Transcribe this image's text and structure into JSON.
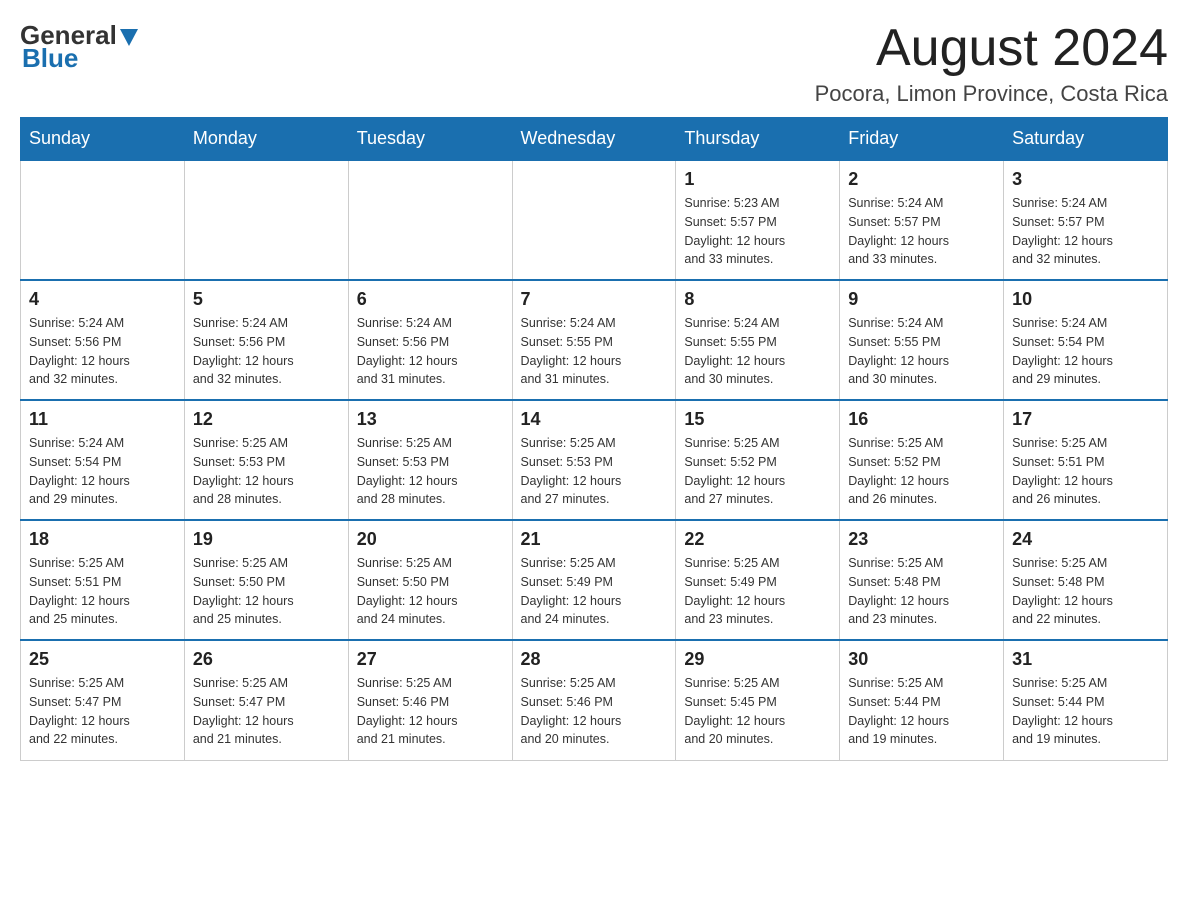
{
  "header": {
    "logo_general": "General",
    "logo_blue": "Blue",
    "month_year": "August 2024",
    "location": "Pocora, Limon Province, Costa Rica"
  },
  "calendar": {
    "days_of_week": [
      "Sunday",
      "Monday",
      "Tuesday",
      "Wednesday",
      "Thursday",
      "Friday",
      "Saturday"
    ],
    "weeks": [
      [
        {
          "day": "",
          "info": ""
        },
        {
          "day": "",
          "info": ""
        },
        {
          "day": "",
          "info": ""
        },
        {
          "day": "",
          "info": ""
        },
        {
          "day": "1",
          "info": "Sunrise: 5:23 AM\nSunset: 5:57 PM\nDaylight: 12 hours\nand 33 minutes."
        },
        {
          "day": "2",
          "info": "Sunrise: 5:24 AM\nSunset: 5:57 PM\nDaylight: 12 hours\nand 33 minutes."
        },
        {
          "day": "3",
          "info": "Sunrise: 5:24 AM\nSunset: 5:57 PM\nDaylight: 12 hours\nand 32 minutes."
        }
      ],
      [
        {
          "day": "4",
          "info": "Sunrise: 5:24 AM\nSunset: 5:56 PM\nDaylight: 12 hours\nand 32 minutes."
        },
        {
          "day": "5",
          "info": "Sunrise: 5:24 AM\nSunset: 5:56 PM\nDaylight: 12 hours\nand 32 minutes."
        },
        {
          "day": "6",
          "info": "Sunrise: 5:24 AM\nSunset: 5:56 PM\nDaylight: 12 hours\nand 31 minutes."
        },
        {
          "day": "7",
          "info": "Sunrise: 5:24 AM\nSunset: 5:55 PM\nDaylight: 12 hours\nand 31 minutes."
        },
        {
          "day": "8",
          "info": "Sunrise: 5:24 AM\nSunset: 5:55 PM\nDaylight: 12 hours\nand 30 minutes."
        },
        {
          "day": "9",
          "info": "Sunrise: 5:24 AM\nSunset: 5:55 PM\nDaylight: 12 hours\nand 30 minutes."
        },
        {
          "day": "10",
          "info": "Sunrise: 5:24 AM\nSunset: 5:54 PM\nDaylight: 12 hours\nand 29 minutes."
        }
      ],
      [
        {
          "day": "11",
          "info": "Sunrise: 5:24 AM\nSunset: 5:54 PM\nDaylight: 12 hours\nand 29 minutes."
        },
        {
          "day": "12",
          "info": "Sunrise: 5:25 AM\nSunset: 5:53 PM\nDaylight: 12 hours\nand 28 minutes."
        },
        {
          "day": "13",
          "info": "Sunrise: 5:25 AM\nSunset: 5:53 PM\nDaylight: 12 hours\nand 28 minutes."
        },
        {
          "day": "14",
          "info": "Sunrise: 5:25 AM\nSunset: 5:53 PM\nDaylight: 12 hours\nand 27 minutes."
        },
        {
          "day": "15",
          "info": "Sunrise: 5:25 AM\nSunset: 5:52 PM\nDaylight: 12 hours\nand 27 minutes."
        },
        {
          "day": "16",
          "info": "Sunrise: 5:25 AM\nSunset: 5:52 PM\nDaylight: 12 hours\nand 26 minutes."
        },
        {
          "day": "17",
          "info": "Sunrise: 5:25 AM\nSunset: 5:51 PM\nDaylight: 12 hours\nand 26 minutes."
        }
      ],
      [
        {
          "day": "18",
          "info": "Sunrise: 5:25 AM\nSunset: 5:51 PM\nDaylight: 12 hours\nand 25 minutes."
        },
        {
          "day": "19",
          "info": "Sunrise: 5:25 AM\nSunset: 5:50 PM\nDaylight: 12 hours\nand 25 minutes."
        },
        {
          "day": "20",
          "info": "Sunrise: 5:25 AM\nSunset: 5:50 PM\nDaylight: 12 hours\nand 24 minutes."
        },
        {
          "day": "21",
          "info": "Sunrise: 5:25 AM\nSunset: 5:49 PM\nDaylight: 12 hours\nand 24 minutes."
        },
        {
          "day": "22",
          "info": "Sunrise: 5:25 AM\nSunset: 5:49 PM\nDaylight: 12 hours\nand 23 minutes."
        },
        {
          "day": "23",
          "info": "Sunrise: 5:25 AM\nSunset: 5:48 PM\nDaylight: 12 hours\nand 23 minutes."
        },
        {
          "day": "24",
          "info": "Sunrise: 5:25 AM\nSunset: 5:48 PM\nDaylight: 12 hours\nand 22 minutes."
        }
      ],
      [
        {
          "day": "25",
          "info": "Sunrise: 5:25 AM\nSunset: 5:47 PM\nDaylight: 12 hours\nand 22 minutes."
        },
        {
          "day": "26",
          "info": "Sunrise: 5:25 AM\nSunset: 5:47 PM\nDaylight: 12 hours\nand 21 minutes."
        },
        {
          "day": "27",
          "info": "Sunrise: 5:25 AM\nSunset: 5:46 PM\nDaylight: 12 hours\nand 21 minutes."
        },
        {
          "day": "28",
          "info": "Sunrise: 5:25 AM\nSunset: 5:46 PM\nDaylight: 12 hours\nand 20 minutes."
        },
        {
          "day": "29",
          "info": "Sunrise: 5:25 AM\nSunset: 5:45 PM\nDaylight: 12 hours\nand 20 minutes."
        },
        {
          "day": "30",
          "info": "Sunrise: 5:25 AM\nSunset: 5:44 PM\nDaylight: 12 hours\nand 19 minutes."
        },
        {
          "day": "31",
          "info": "Sunrise: 5:25 AM\nSunset: 5:44 PM\nDaylight: 12 hours\nand 19 minutes."
        }
      ]
    ]
  }
}
